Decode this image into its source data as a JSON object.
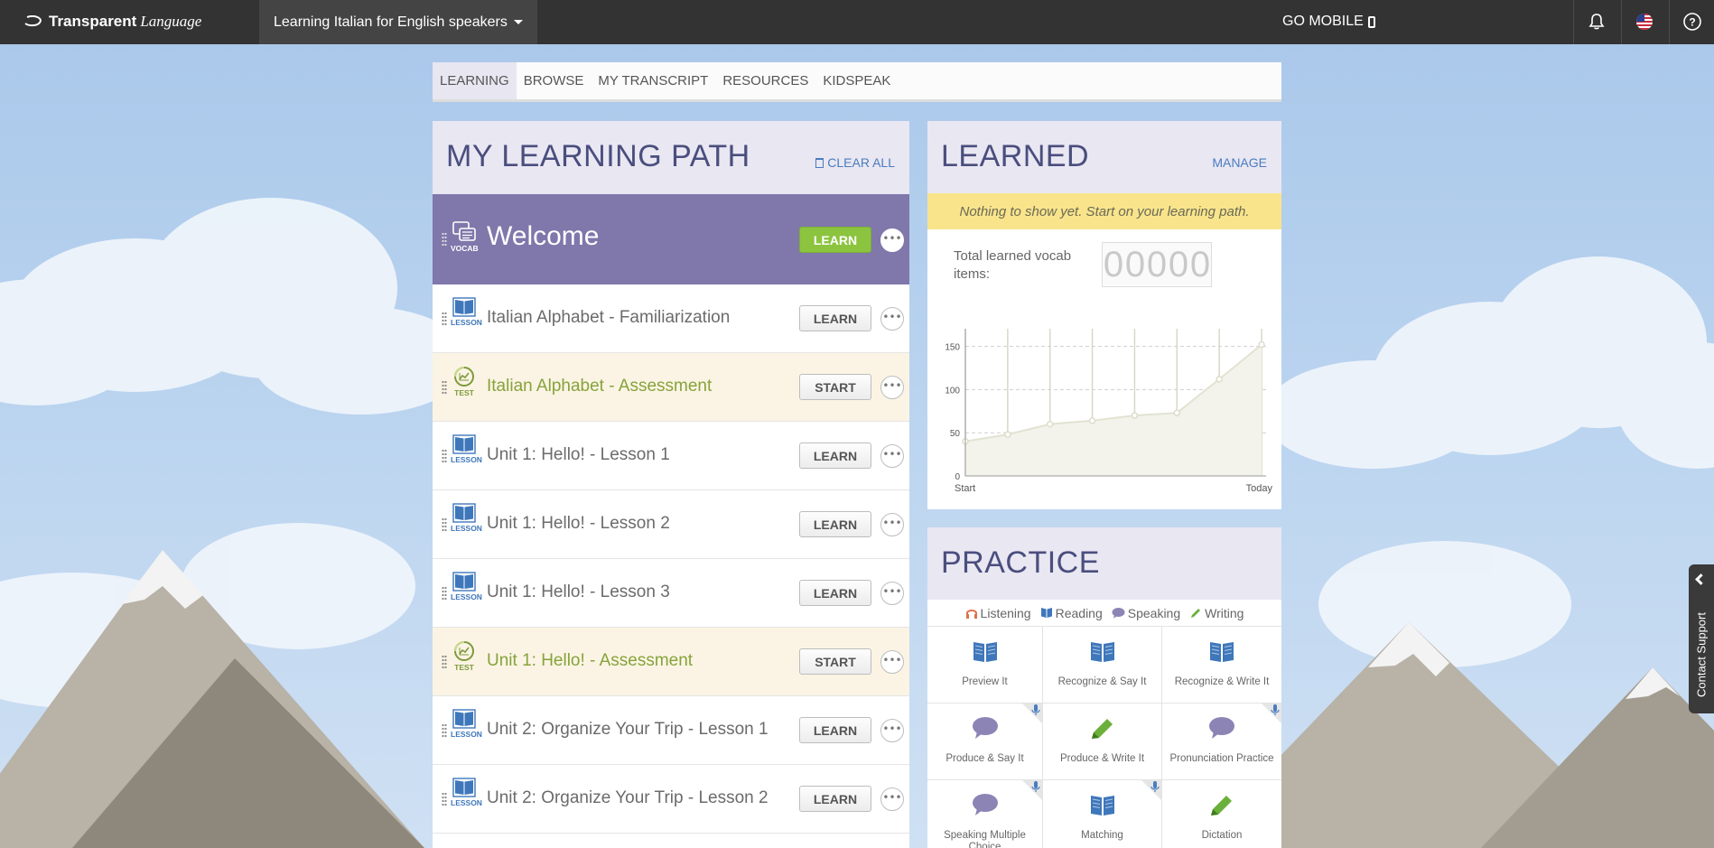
{
  "header": {
    "brand_bold": "Transparent",
    "brand_italic": "Language",
    "course": "Learning Italian for English speakers",
    "go_mobile": "GO MOBILE"
  },
  "tabs": [
    "LEARNING",
    "BROWSE",
    "MY TRANSCRIPT",
    "RESOURCES",
    "KIDSPEAK"
  ],
  "learning_path": {
    "title": "MY LEARNING PATH",
    "clear_all": "CLEAR ALL",
    "items": [
      {
        "type": "VOCAB",
        "title": "Welcome",
        "button": "LEARN"
      },
      {
        "type": "LESSON",
        "title": "Italian Alphabet - Familiarization",
        "button": "LEARN"
      },
      {
        "type": "TEST",
        "title": "Italian Alphabet - Assessment",
        "button": "START"
      },
      {
        "type": "LESSON",
        "title": "Unit 1: Hello! - Lesson 1",
        "button": "LEARN"
      },
      {
        "type": "LESSON",
        "title": "Unit 1: Hello! - Lesson 2",
        "button": "LEARN"
      },
      {
        "type": "LESSON",
        "title": "Unit 1: Hello! - Lesson 3",
        "button": "LEARN"
      },
      {
        "type": "TEST",
        "title": "Unit 1: Hello! - Assessment",
        "button": "START"
      },
      {
        "type": "LESSON",
        "title": "Unit 2: Organize Your Trip - Lesson 1",
        "button": "LEARN"
      },
      {
        "type": "LESSON",
        "title": "Unit 2: Organize Your Trip - Lesson 2",
        "button": "LEARN"
      }
    ]
  },
  "learned": {
    "title": "LEARNED",
    "manage": "MANAGE",
    "notice": "Nothing to show yet. Start on your learning path.",
    "total_label": "Total learned vocab items:",
    "counter_digits": [
      "0",
      "0",
      "0",
      "0",
      "0"
    ]
  },
  "chart_data": {
    "type": "area",
    "x_labels": [
      "Start",
      "Today"
    ],
    "y_ticks": [
      0,
      50,
      100,
      150
    ],
    "ylim": [
      0,
      160
    ],
    "values": [
      40,
      48,
      60,
      64,
      70,
      73,
      112,
      152
    ],
    "grid": true
  },
  "practice": {
    "title": "PRACTICE",
    "skills": [
      "Listening",
      "Reading",
      "Speaking",
      "Writing"
    ],
    "activities": [
      {
        "label": "Preview It",
        "icon": "book-icon",
        "mic": false
      },
      {
        "label": "Recognize & Say It",
        "icon": "book-icon",
        "mic": false
      },
      {
        "label": "Recognize & Write It",
        "icon": "book-icon",
        "mic": false
      },
      {
        "label": "Produce & Say It",
        "icon": "speech-bubble-icon",
        "mic": true
      },
      {
        "label": "Produce & Write It",
        "icon": "pencil-icon",
        "mic": false
      },
      {
        "label": "Pronunciation Practice",
        "icon": "speech-bubble-icon",
        "mic": true
      },
      {
        "label": "Speaking Multiple Choice",
        "icon": "speech-bubble-icon",
        "mic": true
      },
      {
        "label": "Matching",
        "icon": "book-icon",
        "mic": true
      },
      {
        "label": "Dictation",
        "icon": "pencil-icon",
        "mic": false
      }
    ]
  },
  "contact_support": "Contact Support",
  "colors": {
    "topbar": "#333333",
    "accent_purple": "#8077ab",
    "learn_green": "#8cc43f",
    "link_blue": "#4a7cc0",
    "notice_yellow": "#f9e48c"
  }
}
